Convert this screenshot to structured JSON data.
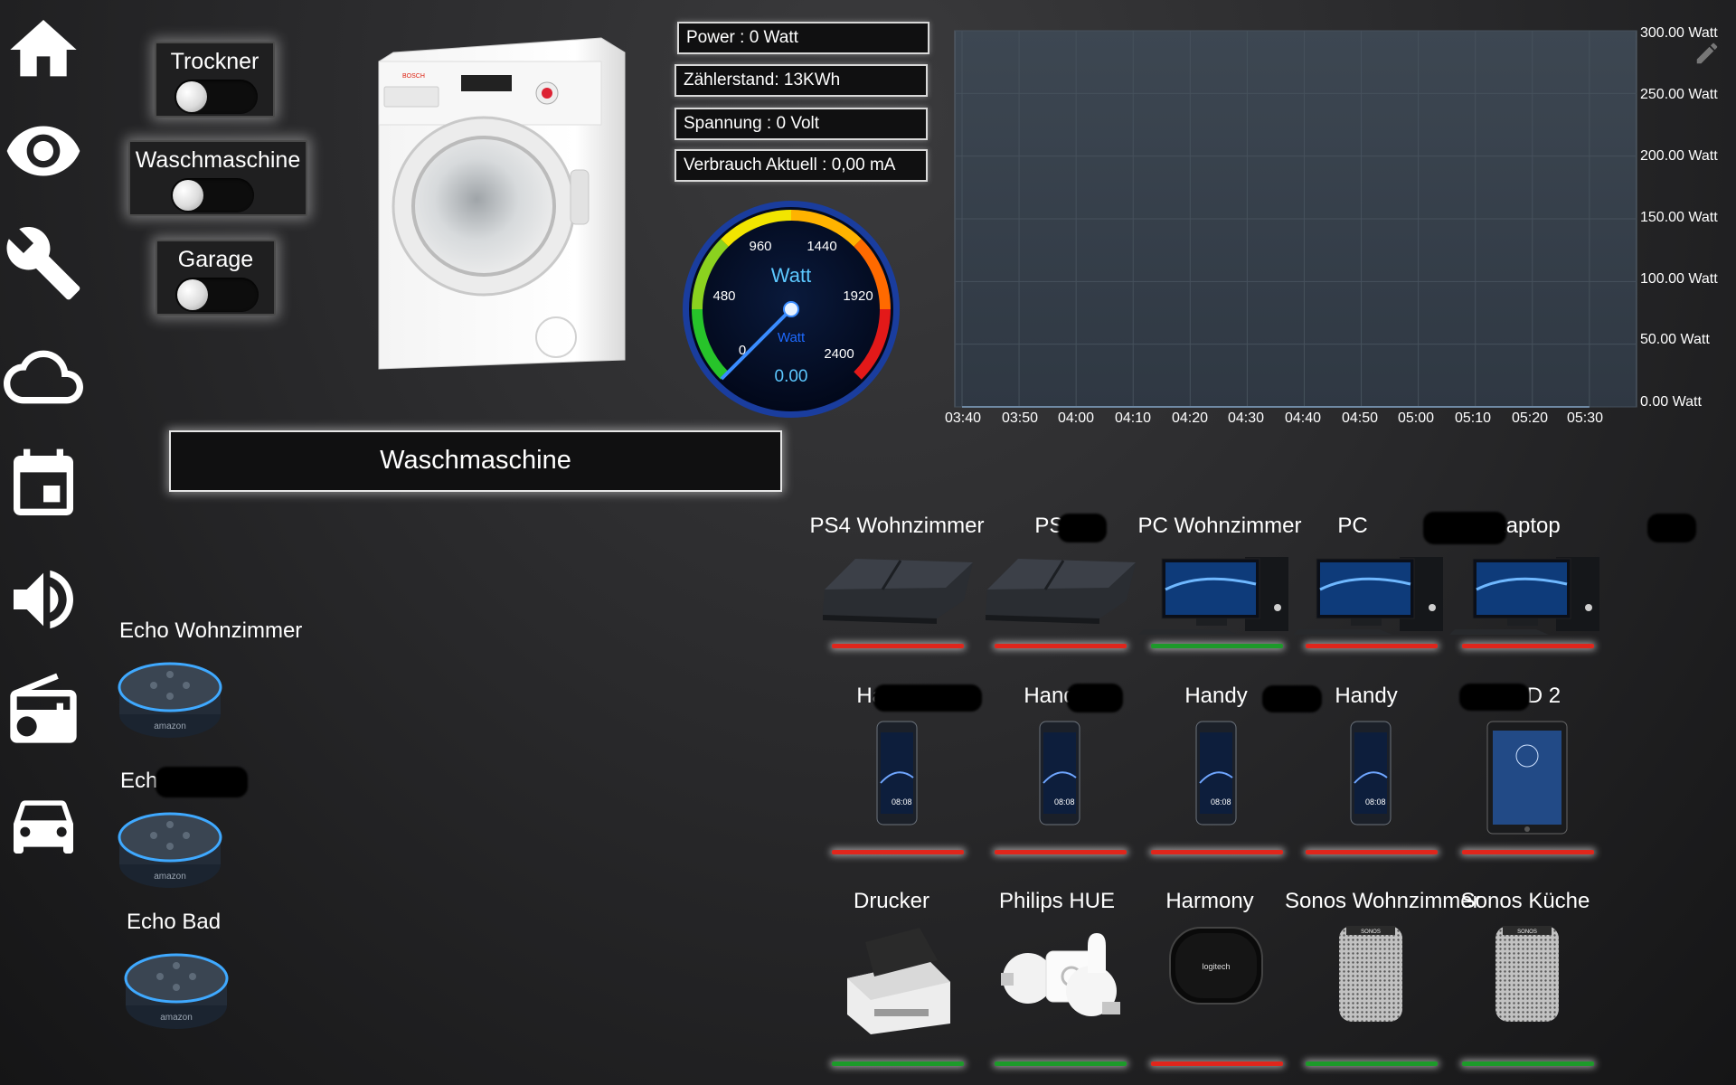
{
  "sidebar": {
    "items": [
      {
        "icon": "home-icon"
      },
      {
        "icon": "eye-icon"
      },
      {
        "icon": "wrench-icon"
      },
      {
        "icon": "cloud-icon"
      },
      {
        "icon": "calendar-icon"
      },
      {
        "icon": "speaker-icon"
      },
      {
        "icon": "radio-icon"
      },
      {
        "icon": "car-icon"
      }
    ]
  },
  "switches": [
    {
      "label": "Trockner",
      "state": "off"
    },
    {
      "label": "Waschmaschine",
      "state": "off"
    },
    {
      "label": "Garage",
      "state": "off"
    }
  ],
  "info": {
    "power": "Power : 0 Watt",
    "meter": "Zählerstand: 13KWh",
    "voltage": "Spannung : 0 Volt",
    "current": "Verbrauch Aktuell : 0,00 mA"
  },
  "gauge": {
    "unit": "Watt",
    "unit_small": "Watt",
    "value": "0.00",
    "ticks": [
      "0",
      "480",
      "960",
      "1440",
      "1920",
      "2400"
    ]
  },
  "main_button": "Waschmaschine",
  "chart_data": {
    "type": "area",
    "x": [
      "03:40",
      "03:50",
      "04:00",
      "04:10",
      "04:20",
      "04:30",
      "04:40",
      "04:50",
      "05:00",
      "05:10",
      "05:20",
      "05:30"
    ],
    "series": [
      {
        "values": [
          0,
          0,
          0,
          0,
          0,
          0,
          0,
          0,
          0,
          0,
          0,
          0
        ]
      }
    ],
    "y_ticks": [
      "300.00 Watt",
      "250.00 Watt",
      "200.00 Watt",
      "150.00 Watt",
      "100.00 Watt",
      "50.00 Watt",
      "0.00 Watt"
    ],
    "ylim": [
      0,
      300
    ],
    "grid": true
  },
  "devices": [
    {
      "name": "PS4 Wohnzimmer",
      "status": "red",
      "type": "ps4"
    },
    {
      "name": "PS4",
      "status": "red",
      "type": "ps4"
    },
    {
      "name": "PC Wohnzimmer",
      "status": "green",
      "type": "pc"
    },
    {
      "name": "PC",
      "status": "red",
      "type": "pc"
    },
    {
      "name": "Laptop",
      "status": "red",
      "type": "pc"
    },
    {
      "name": "Handy",
      "status": "red",
      "type": "phone"
    },
    {
      "name": "Handy",
      "status": "red",
      "type": "phone"
    },
    {
      "name": "Handy",
      "status": "red",
      "type": "phone"
    },
    {
      "name": "Handy",
      "status": "red",
      "type": "phone"
    },
    {
      "name": "IPAD 2",
      "status": "red",
      "type": "tablet"
    },
    {
      "name": "Drucker",
      "status": "green",
      "type": "printer"
    },
    {
      "name": "Philips HUE",
      "status": "green",
      "type": "hue"
    },
    {
      "name": "Harmony",
      "status": "red",
      "type": "harmony"
    },
    {
      "name": "Sonos Wohnzimmer",
      "status": "green",
      "type": "sonos"
    },
    {
      "name": "Sonos Küche",
      "status": "green",
      "type": "sonos"
    }
  ],
  "echos": [
    {
      "name": "Echo Wohnzimmer",
      "brand": "amazon"
    },
    {
      "name": "Ech",
      "brand": "amazon"
    },
    {
      "name": "Echo Bad",
      "brand": "amazon"
    }
  ],
  "colors": {
    "status_red": "#e0261c",
    "status_green": "#1d9a2a",
    "chart_bg": "#3a4550"
  }
}
